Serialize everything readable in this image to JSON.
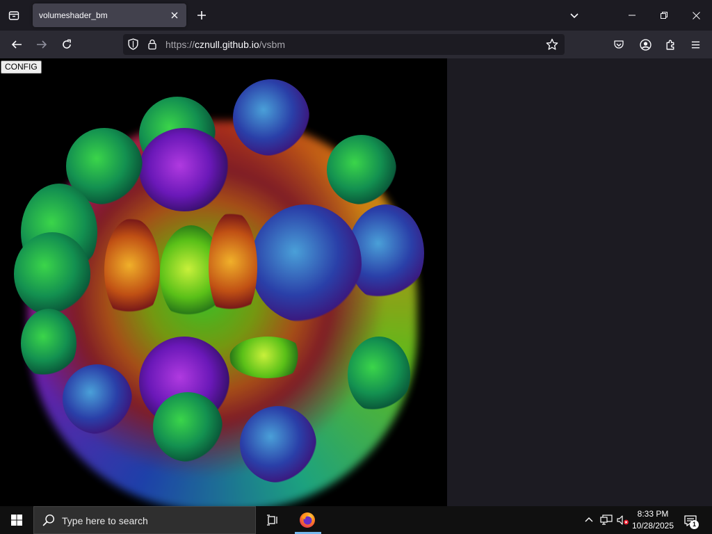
{
  "browser": {
    "tab": {
      "title": "volumeshader_bm"
    },
    "url": {
      "scheme": "https://",
      "host": "cznull.github.io",
      "path": "/vsbm"
    }
  },
  "page": {
    "config_label": "CONFIG"
  },
  "taskbar": {
    "search_placeholder": "Type here to search",
    "time": "8:33 PM",
    "date": "10/28/2025",
    "notification_count": "1"
  },
  "colors": {
    "tabstrip": "#1c1b22",
    "navbar": "#2b2a33",
    "active_tab": "#42414d",
    "canvas": "#000000",
    "taskbar": "#101010"
  },
  "icons": [
    "tab-list-icon",
    "close-icon",
    "plus-icon",
    "chevron-down-icon",
    "minimize-icon",
    "restore-icon",
    "back-arrow-icon",
    "forward-arrow-icon",
    "reload-icon",
    "shield-icon",
    "lock-icon",
    "star-icon",
    "pocket-icon",
    "account-icon",
    "extensions-icon",
    "hamburger-menu-icon",
    "windows-logo-icon",
    "search-icon",
    "task-view-icon",
    "firefox-icon",
    "chevron-up-icon",
    "network-icon",
    "volume-muted-icon",
    "notification-icon"
  ]
}
